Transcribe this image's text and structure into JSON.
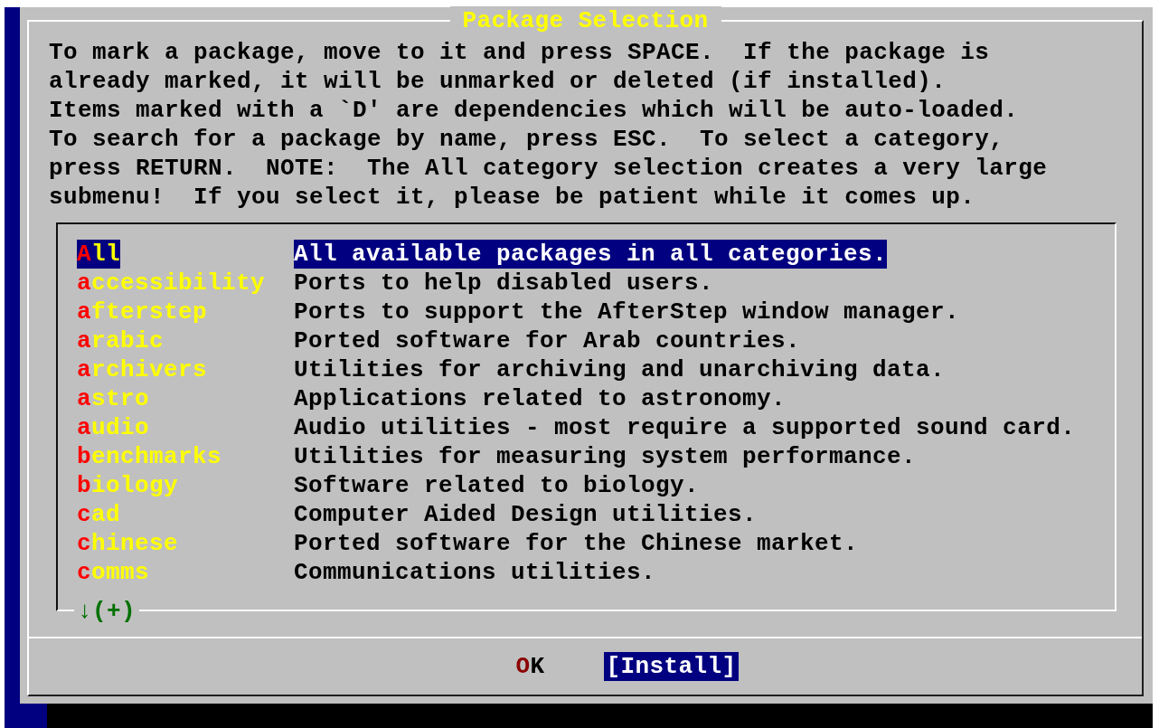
{
  "dialog": {
    "title": "Package Selection",
    "instructions": [
      "To mark a package, move to it and press SPACE.  If the package is",
      "already marked, it will be unmarked or deleted (if installed).",
      "Items marked with a `D' are dependencies which will be auto-loaded.",
      "To search for a package by name, press ESC.  To select a category,",
      "press RETURN.  NOTE:  The All category selection creates a very large",
      "submenu!  If you select it, please be patient while it comes up."
    ],
    "categories": [
      {
        "name": "All",
        "description": "All available packages in all categories.",
        "selected": true
      },
      {
        "name": "accessibility",
        "description": "Ports to help disabled users.",
        "selected": false
      },
      {
        "name": "afterstep",
        "description": "Ports to support the AfterStep window manager.",
        "selected": false
      },
      {
        "name": "arabic",
        "description": "Ported software for Arab countries.",
        "selected": false
      },
      {
        "name": "archivers",
        "description": "Utilities for archiving and unarchiving data.",
        "selected": false
      },
      {
        "name": "astro",
        "description": "Applications related to astronomy.",
        "selected": false
      },
      {
        "name": "audio",
        "description": "Audio utilities - most require a supported sound card.",
        "selected": false
      },
      {
        "name": "benchmarks",
        "description": "Utilities for measuring system performance.",
        "selected": false
      },
      {
        "name": "biology",
        "description": "Software related to biology.",
        "selected": false
      },
      {
        "name": "cad",
        "description": "Computer Aided Design utilities.",
        "selected": false
      },
      {
        "name": "chinese",
        "description": "Ported software for the Chinese market.",
        "selected": false
      },
      {
        "name": "comms",
        "description": "Communications utilities.",
        "selected": false
      }
    ],
    "more_indicator": "↓(+)",
    "buttons": [
      {
        "label": "OK",
        "selected": false
      },
      {
        "label": "[Install]",
        "selected": true
      }
    ]
  }
}
